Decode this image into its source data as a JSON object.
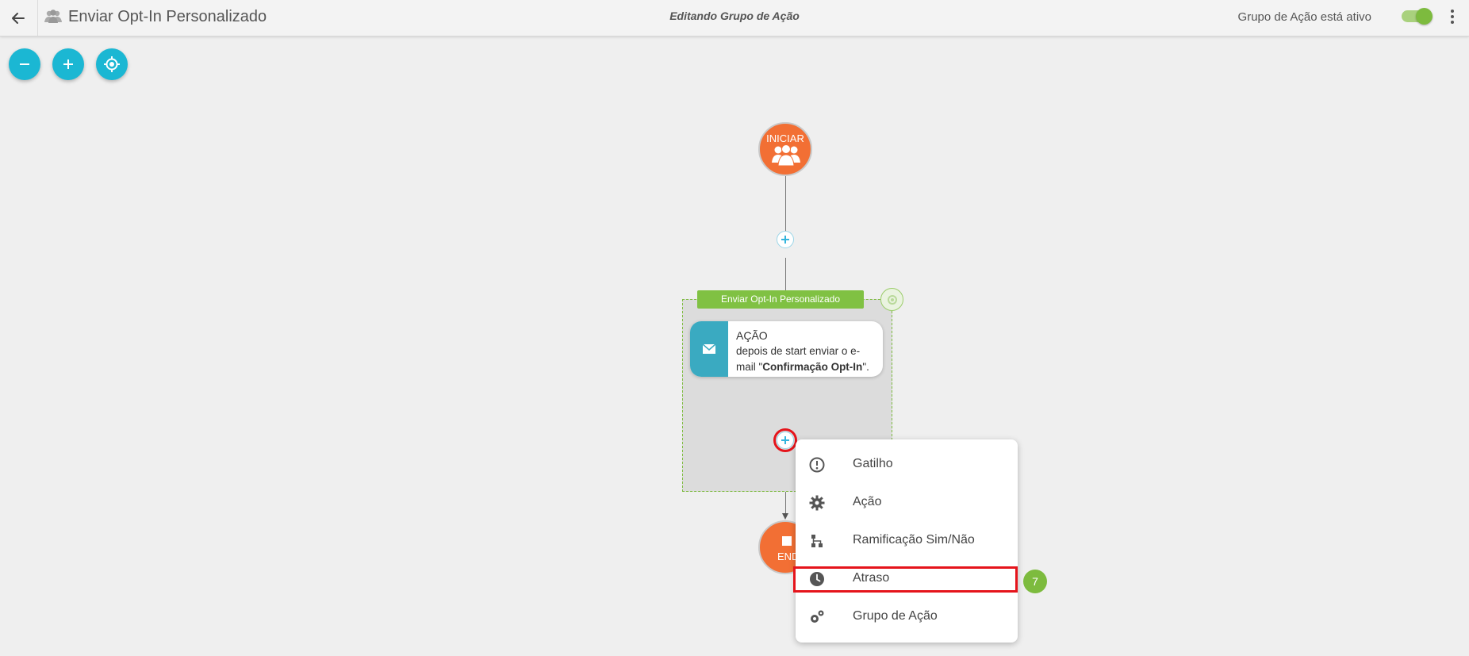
{
  "header": {
    "title": "Enviar Opt-In Personalizado",
    "center_title": "Editando Grupo de Ação",
    "active_label": "Grupo de Ação está ativo",
    "active": true
  },
  "canvas": {
    "start_label": "INICIAR",
    "end_label": "END",
    "group_name": "Enviar Opt-In Personalizado",
    "action": {
      "title": "AÇÃO",
      "description_prefix": "depois de start enviar o e-mail \"",
      "email_name": "Confirmação Opt-In",
      "description_suffix": "\"."
    }
  },
  "menu": {
    "items": [
      {
        "label": "Gatilho",
        "icon": "alert-circle-icon"
      },
      {
        "label": "Ação",
        "icon": "gear-icon"
      },
      {
        "label": "Ramificação Sim/Não",
        "icon": "branch-icon"
      },
      {
        "label": "Atraso",
        "icon": "clock-icon"
      },
      {
        "label": "Grupo de Ação",
        "icon": "gears-icon"
      }
    ]
  },
  "annotation": {
    "step_number": "7"
  },
  "colors": {
    "accent": "#1bb7d3",
    "node": "#f26f34",
    "group": "#80c143",
    "highlight": "#e5141b"
  }
}
